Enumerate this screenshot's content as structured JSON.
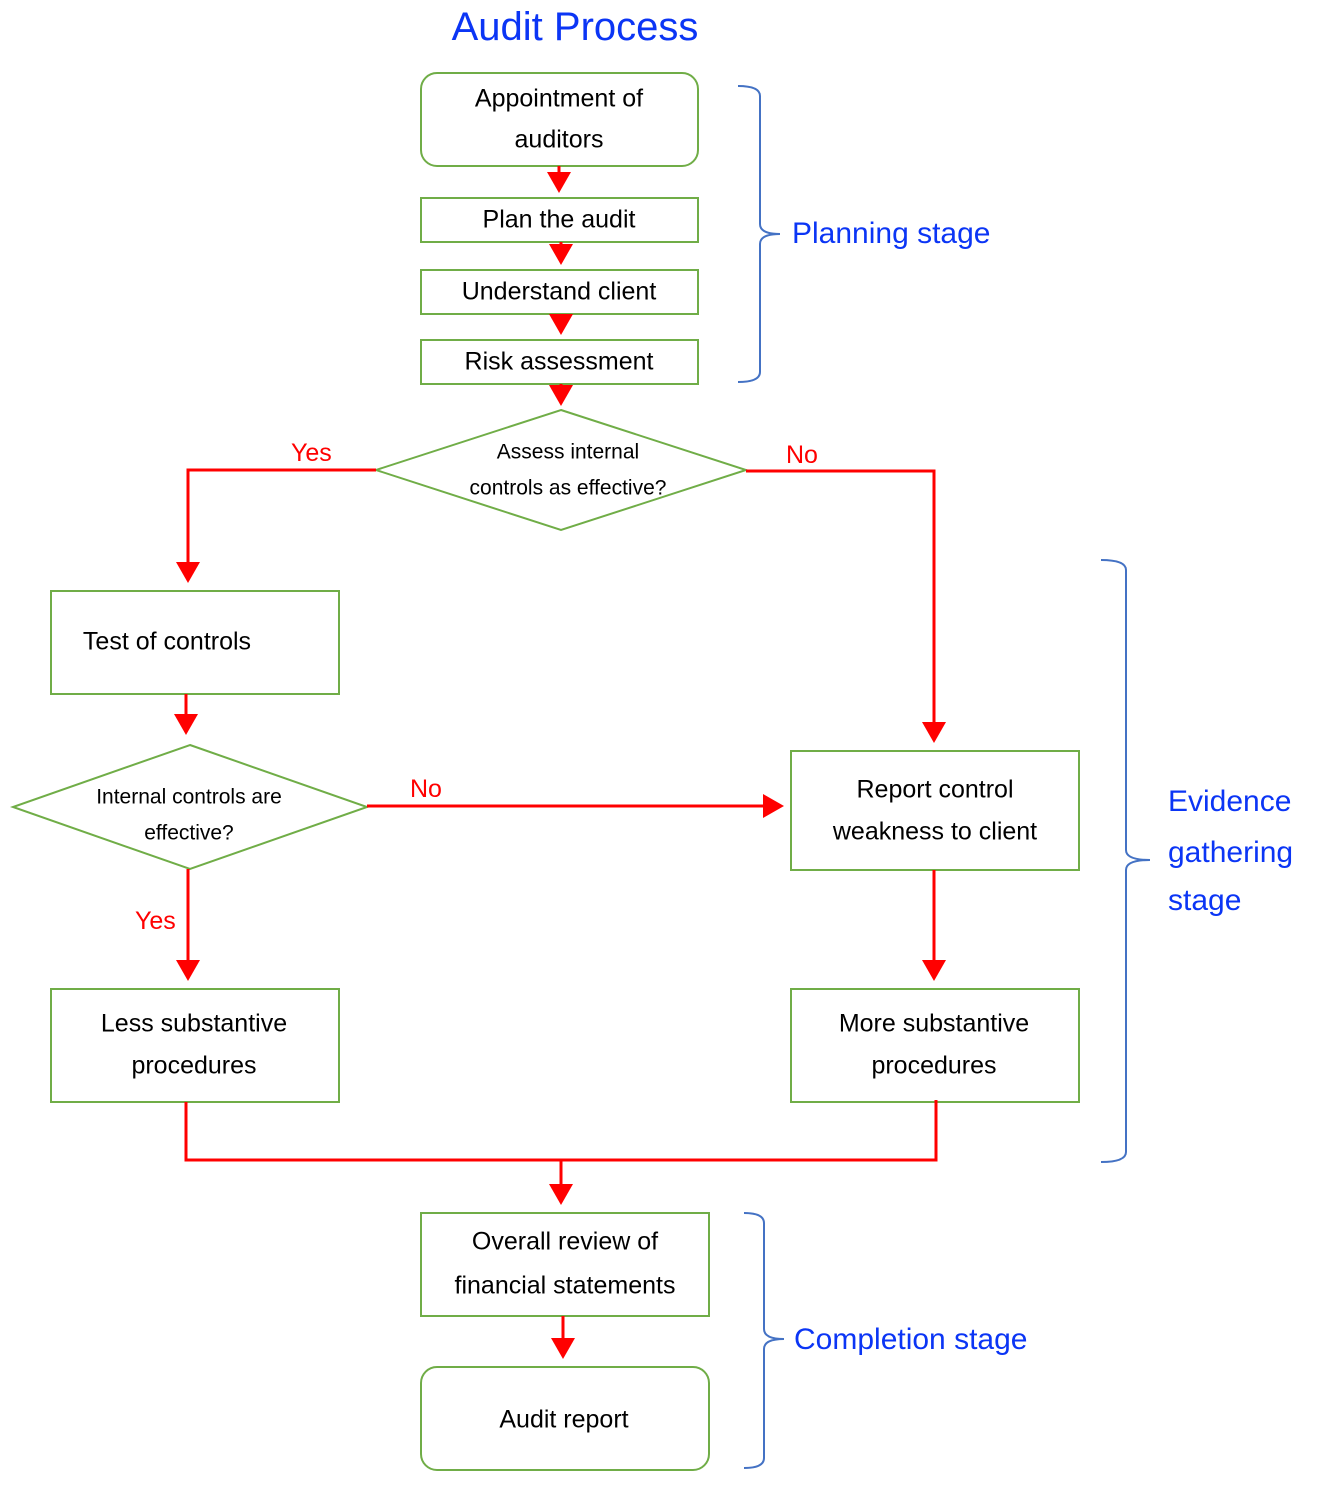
{
  "title": "Audit Process",
  "nodes": {
    "appointment": [
      "Appointment of",
      "auditors"
    ],
    "plan": "Plan the audit",
    "understand": "Understand client",
    "risk": "Risk assessment",
    "assess_decision": [
      "Assess internal",
      "controls as effective?"
    ],
    "test_controls": "Test of controls",
    "effective_decision": [
      "Internal controls are",
      "effective?"
    ],
    "report_weakness": [
      "Report control",
      "weakness to client"
    ],
    "less_substantive": [
      "Less substantive",
      "procedures"
    ],
    "more_substantive": [
      "More substantive",
      "procedures"
    ],
    "overall_review": [
      "Overall review of",
      "financial statements"
    ],
    "audit_report": "Audit report"
  },
  "edge_labels": {
    "assess_yes": "Yes",
    "assess_no": "No",
    "effective_no": "No",
    "effective_yes": "Yes"
  },
  "stages": {
    "planning": [
      "Planning stage"
    ],
    "evidence": [
      "Evidence",
      "gathering",
      "stage"
    ],
    "completion": [
      "Completion stage"
    ]
  },
  "colors": {
    "title": "#0b35f5",
    "box_border": "#70ad47",
    "arrow": "#ff0000",
    "brace": "#4472c4"
  }
}
